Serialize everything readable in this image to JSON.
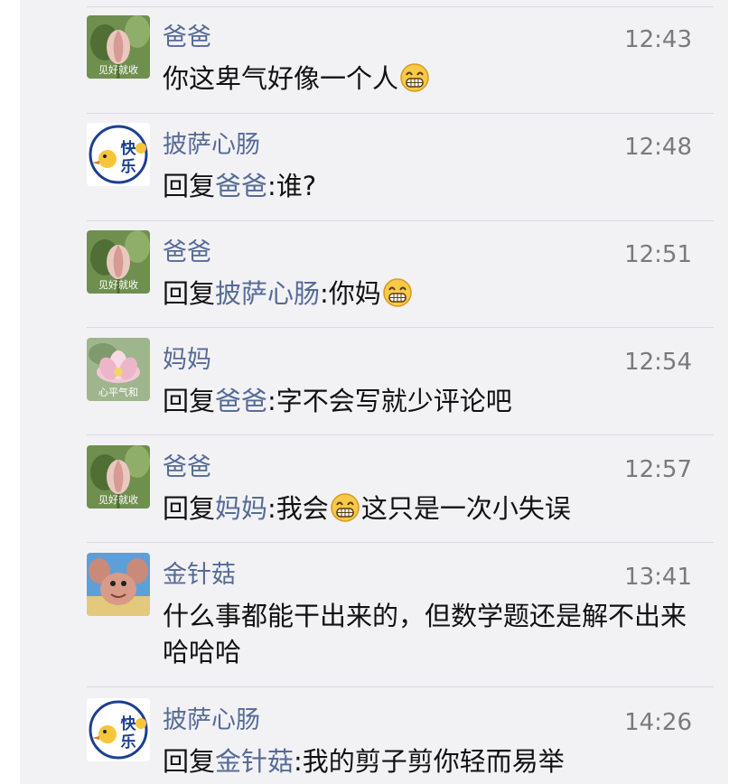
{
  "comments": [
    {
      "name": "爸爸",
      "time": "12:43",
      "avatar": "lotus-bud",
      "avatar_text": "见好就收",
      "parts": [
        {
          "t": "text",
          "v": "你这卑气好像一个人"
        },
        {
          "t": "emoji",
          "v": "grin-emoji"
        }
      ]
    },
    {
      "name": "披萨心肠",
      "time": "12:48",
      "avatar": "duck-cartoon",
      "avatar_text": "快乐ing",
      "parts": [
        {
          "t": "text",
          "v": "回复"
        },
        {
          "t": "mention",
          "v": "爸爸"
        },
        {
          "t": "text",
          "v": ":谁?"
        }
      ]
    },
    {
      "name": "爸爸",
      "time": "12:51",
      "avatar": "lotus-bud",
      "avatar_text": "见好就收",
      "parts": [
        {
          "t": "text",
          "v": "回复"
        },
        {
          "t": "mention",
          "v": "披萨心肠"
        },
        {
          "t": "text",
          "v": ":你妈"
        },
        {
          "t": "emoji",
          "v": "grin-emoji"
        }
      ]
    },
    {
      "name": "妈妈",
      "time": "12:54",
      "avatar": "lotus-flower",
      "avatar_text": "心平气和",
      "parts": [
        {
          "t": "text",
          "v": "回复"
        },
        {
          "t": "mention",
          "v": "爸爸"
        },
        {
          "t": "text",
          "v": ":字不会写就少评论吧"
        }
      ]
    },
    {
      "name": "爸爸",
      "time": "12:57",
      "avatar": "lotus-bud",
      "avatar_text": "见好就收",
      "parts": [
        {
          "t": "text",
          "v": "回复"
        },
        {
          "t": "mention",
          "v": "妈妈"
        },
        {
          "t": "text",
          "v": ":我会"
        },
        {
          "t": "emoji",
          "v": "grin-emoji"
        },
        {
          "t": "text",
          "v": "这只是一次小失误"
        }
      ]
    },
    {
      "name": "金针菇",
      "time": "13:41",
      "avatar": "cartoon-character",
      "parts": [
        {
          "t": "text",
          "v": "什么事都能干出来的，但数学题还是解不出来哈哈哈"
        }
      ]
    },
    {
      "name": "披萨心肠",
      "time": "14:26",
      "avatar": "duck-cartoon",
      "avatar_text": "快乐ing",
      "parts": [
        {
          "t": "text",
          "v": "回复"
        },
        {
          "t": "mention",
          "v": "金针菇"
        },
        {
          "t": "text",
          "v": ":我的剪子剪你轻而易举"
        }
      ]
    }
  ],
  "colors": {
    "name": "#566b96",
    "mention": "#566b96",
    "text": "#111111",
    "time": "#7a7a7a",
    "panel": "#f2f2f5"
  }
}
